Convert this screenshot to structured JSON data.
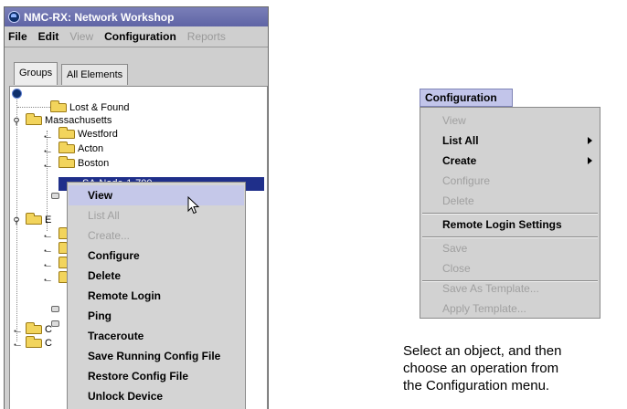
{
  "window": {
    "title": "NMC-RX: Network Workshop",
    "menu": [
      {
        "label": "File",
        "enabled": true
      },
      {
        "label": "Edit",
        "enabled": true
      },
      {
        "label": "View",
        "enabled": false
      },
      {
        "label": "Configuration",
        "enabled": true
      },
      {
        "label": "Reports",
        "enabled": false
      }
    ],
    "tabs": [
      {
        "label": "Groups",
        "active": true
      },
      {
        "label": "All Elements",
        "active": false
      }
    ]
  },
  "tree": {
    "lost_found": "Lost & Found",
    "massachusetts": "Massachusetts",
    "westford": "Westford",
    "acton": "Acton",
    "boston": "Boston",
    "selected_device": "SA-Node-1-700",
    "partial_e": "E",
    "partial_c1": "C",
    "partial_c2": "C"
  },
  "context_menu": {
    "items": [
      {
        "label": "View",
        "enabled": true,
        "hovered": true
      },
      {
        "label": "List All",
        "enabled": false
      },
      {
        "label": "Create...",
        "enabled": false
      },
      {
        "label": "Configure",
        "enabled": true
      },
      {
        "label": "Delete",
        "enabled": true
      },
      {
        "label": "Remote Login",
        "enabled": true
      },
      {
        "label": "Ping",
        "enabled": true
      },
      {
        "label": "Traceroute",
        "enabled": true
      },
      {
        "label": "Save Running Config File",
        "enabled": true
      },
      {
        "label": "Restore Config File",
        "enabled": true
      },
      {
        "label": "Unlock Device",
        "enabled": true
      }
    ]
  },
  "config_menu": {
    "title": "Configuration",
    "items": [
      {
        "label": "View",
        "enabled": false
      },
      {
        "label": "List All",
        "enabled": true,
        "submenu": true
      },
      {
        "label": "Create",
        "enabled": true,
        "submenu": true
      },
      {
        "label": "Configure",
        "enabled": false
      },
      {
        "label": "Delete",
        "enabled": false
      },
      {
        "label": "Remote Login Settings",
        "enabled": true
      },
      {
        "label": "Save",
        "enabled": false
      },
      {
        "label": "Close",
        "enabled": false
      },
      {
        "label": "Save As Template...",
        "enabled": false
      },
      {
        "label": "Apply Template...",
        "enabled": false
      }
    ]
  },
  "caption": {
    "line1": "Select an object, and then",
    "line2": "choose an operation from",
    "line3": "the Configuration menu."
  },
  "colors": {
    "title_bar": "#6a6fae",
    "selection": "#1f2f8a",
    "folder": "#f2d45c",
    "disabled_text": "#a0a0a0"
  }
}
